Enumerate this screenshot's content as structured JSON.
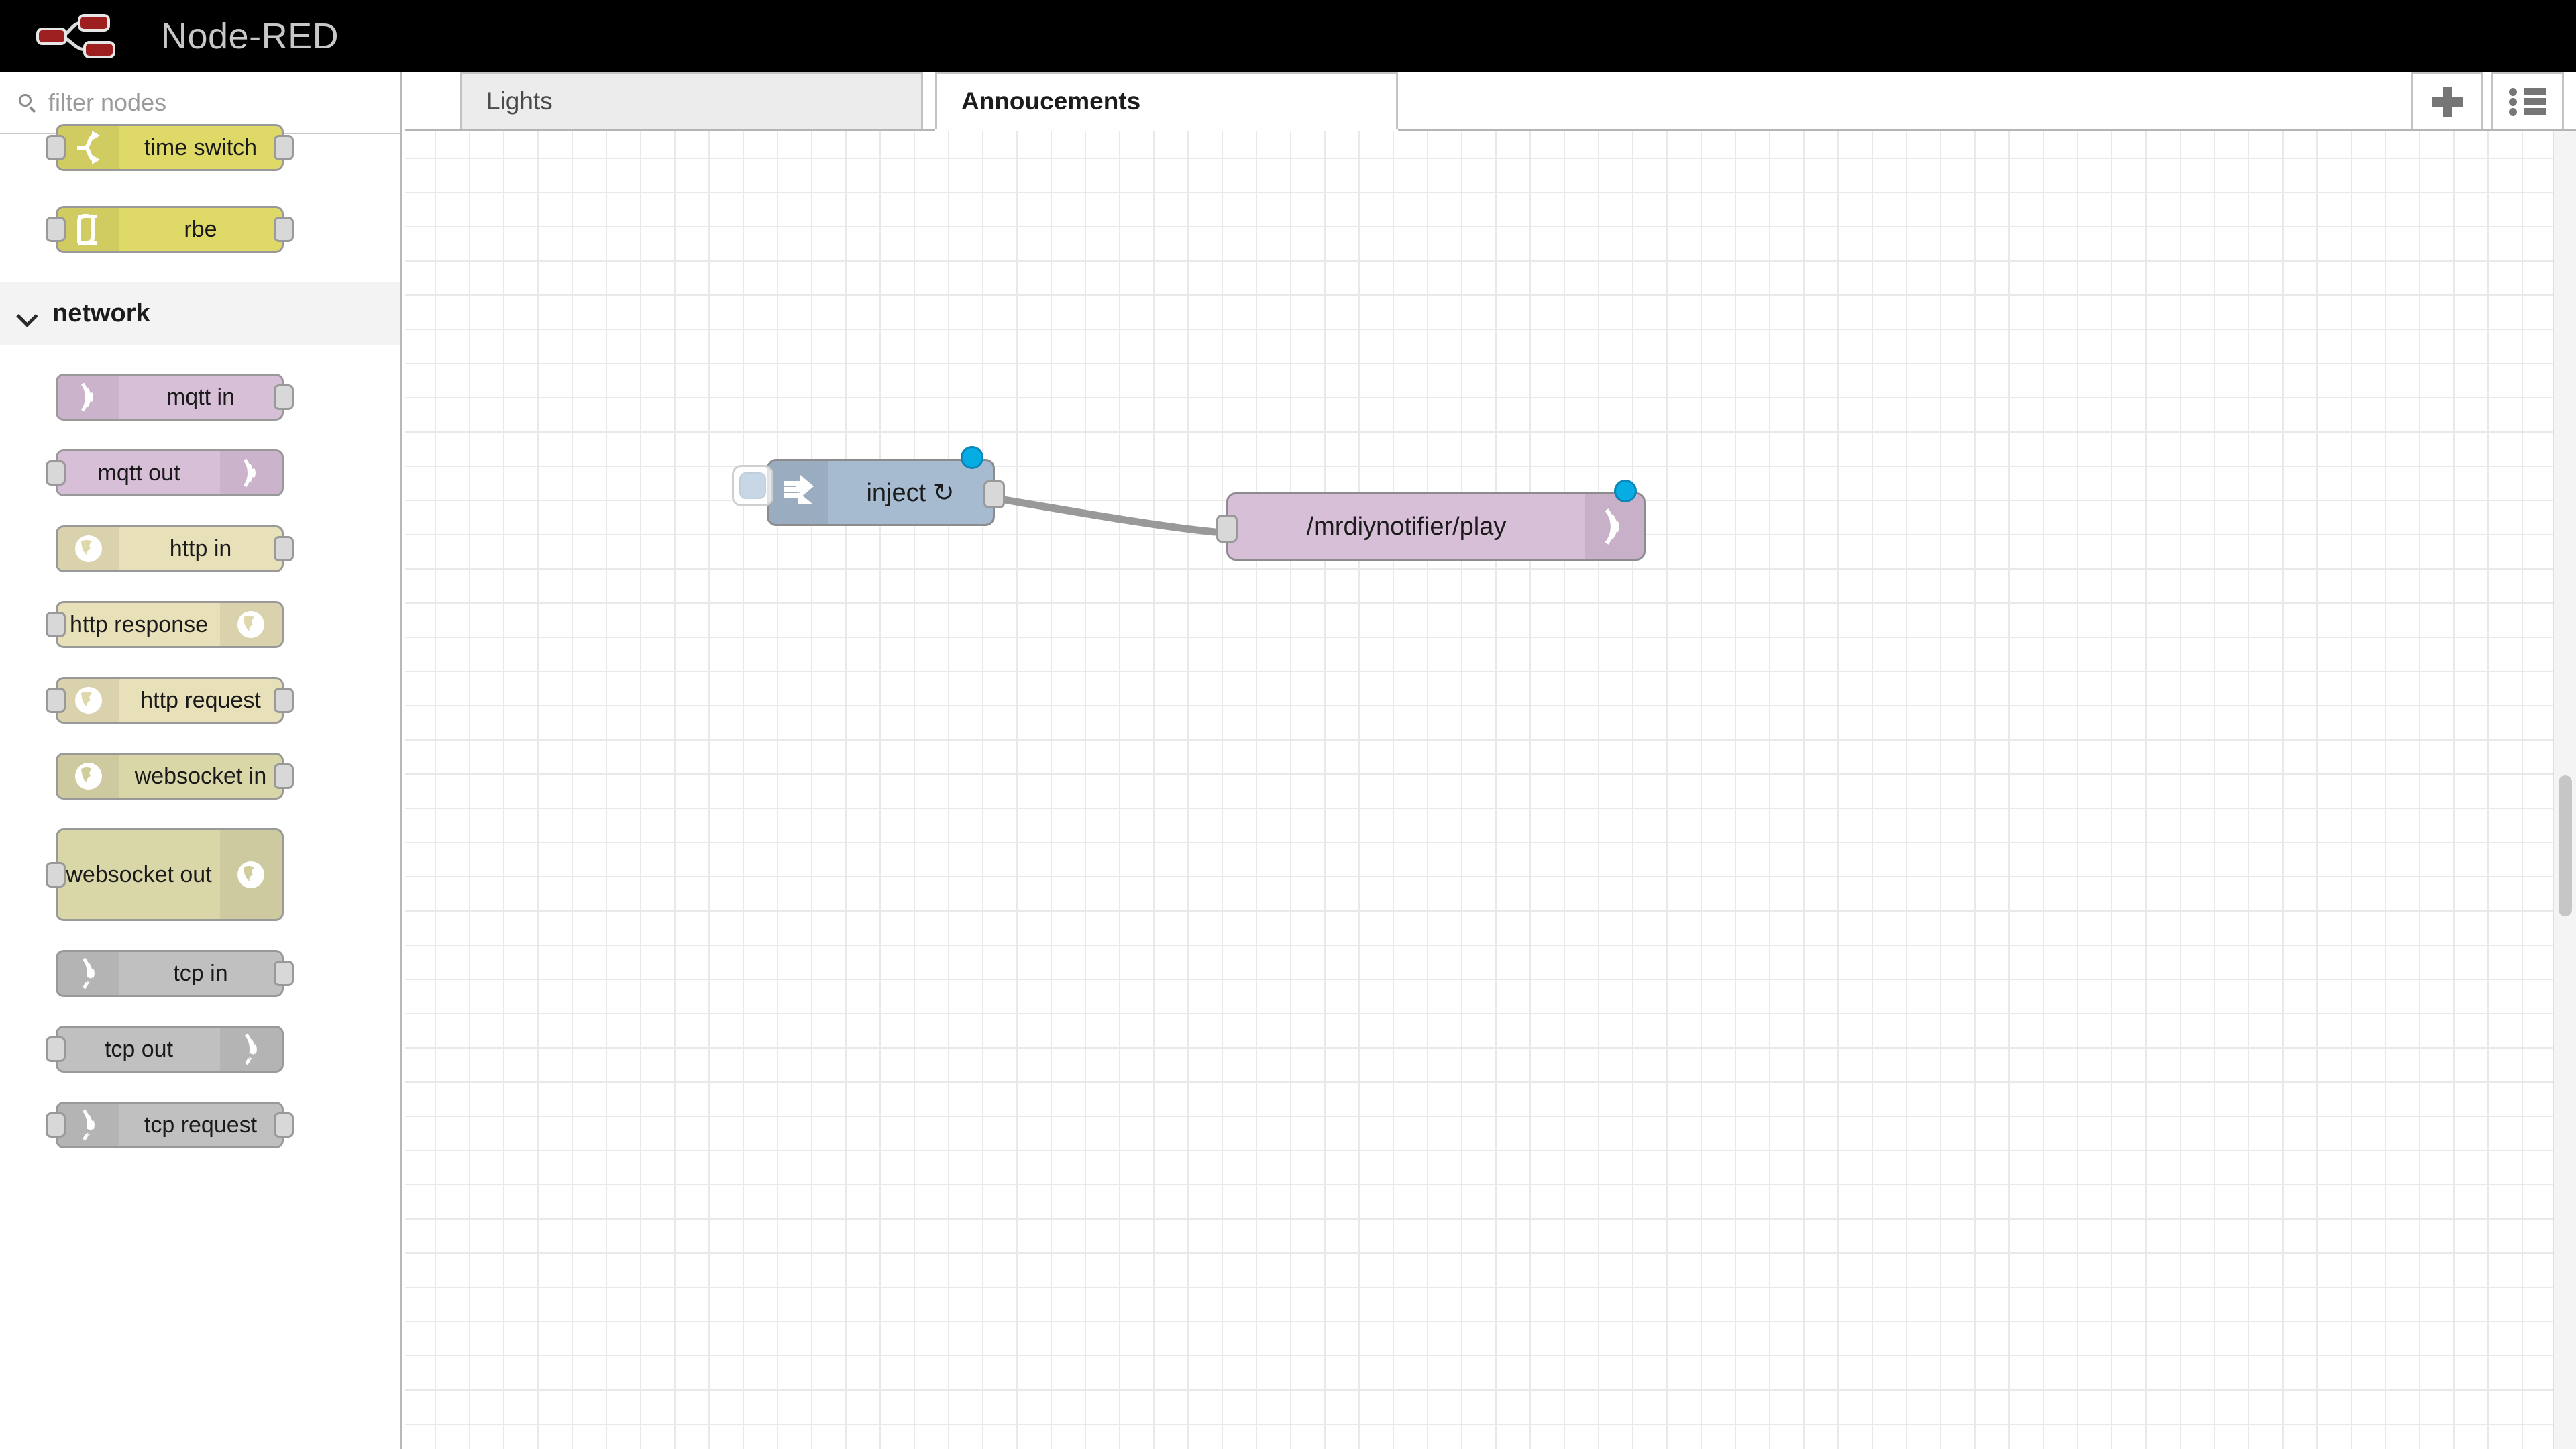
{
  "header": {
    "app_title": "Node-RED",
    "logo_icon": "node-red-logo-icon",
    "logo_color": "#8f1d1d"
  },
  "palette": {
    "search": {
      "placeholder": "filter nodes",
      "value": "",
      "icon": "search-icon"
    },
    "top_nodes": [
      {
        "label": "time switch",
        "icon": "time-switch-icon",
        "color": "#dfd968",
        "icon_side": "left",
        "has_input": true,
        "has_output": true
      },
      {
        "label": "rbe",
        "icon": "rbe-icon",
        "color": "#dfd968",
        "icon_side": "left",
        "has_input": true,
        "has_output": true
      }
    ],
    "category": {
      "label": "network",
      "icon": "chevron-down-icon",
      "expanded": true
    },
    "network_nodes": [
      {
        "label": "mqtt in",
        "icon": "mqtt-wave-icon",
        "color": "#d8bfd8",
        "icon_side": "left",
        "has_input": false,
        "has_output": true
      },
      {
        "label": "mqtt out",
        "icon": "mqtt-wave-icon",
        "color": "#d8bfd8",
        "icon_side": "right",
        "has_input": true,
        "has_output": false
      },
      {
        "label": "http in",
        "icon": "globe-icon",
        "color": "#e7e0b8",
        "icon_side": "left",
        "has_input": false,
        "has_output": true
      },
      {
        "label": "http response",
        "icon": "globe-icon",
        "color": "#e7e0b8",
        "icon_side": "right",
        "has_input": true,
        "has_output": false
      },
      {
        "label": "http request",
        "icon": "globe-icon",
        "color": "#e7e0b8",
        "icon_side": "left",
        "has_input": true,
        "has_output": true
      },
      {
        "label": "websocket in",
        "icon": "globe-icon",
        "color": "#d9d7a8",
        "icon_side": "left",
        "has_input": false,
        "has_output": true
      },
      {
        "label": "websocket out",
        "icon": "globe-icon",
        "color": "#d9d7a8",
        "icon_side": "right",
        "has_input": true,
        "has_output": false,
        "tall": true
      },
      {
        "label": "tcp in",
        "icon": "signal-wave-icon",
        "color": "#c0c0c0",
        "icon_side": "left",
        "has_input": false,
        "has_output": true
      },
      {
        "label": "tcp out",
        "icon": "signal-wave-icon",
        "color": "#c0c0c0",
        "icon_side": "right",
        "has_input": true,
        "has_output": false
      },
      {
        "label": "tcp request",
        "icon": "signal-wave-icon",
        "color": "#c0c0c0",
        "icon_side": "left",
        "has_input": true,
        "has_output": true
      }
    ]
  },
  "workspace": {
    "tabs": [
      {
        "label": "Lights",
        "active": false
      },
      {
        "label": "Annoucements",
        "active": true
      }
    ],
    "toolbar": [
      {
        "name": "add-flow-button",
        "icon": "plus-icon",
        "label": "+"
      },
      {
        "name": "flow-menu-button",
        "icon": "list-icon",
        "label": ""
      }
    ],
    "flow_nodes": [
      {
        "id": "inject",
        "label": "inject ↻",
        "icon": "inject-arrow-icon",
        "color": "#a6bbcf",
        "icon_side": "left",
        "status_dot_color": "#06ace4",
        "has_output": true,
        "has_input": false
      },
      {
        "id": "mqtt-out",
        "label": "/mrdiynotifier/play",
        "icon": "mqtt-wave-icon",
        "color": "#d8bfd8",
        "icon_side": "right",
        "status_dot_color": "#06ace4",
        "has_output": false,
        "has_input": true
      }
    ],
    "wire": {
      "from": "inject",
      "to": "mqtt-out",
      "color": "#999999"
    }
  }
}
